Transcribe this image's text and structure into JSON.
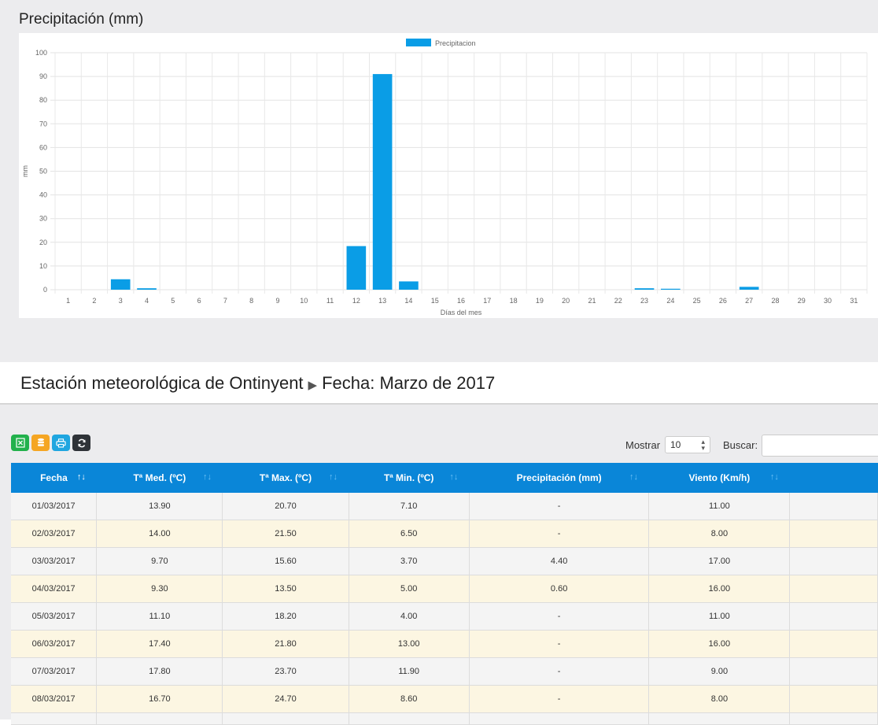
{
  "chart_title": "Precipitación (mm)",
  "chart_data": {
    "type": "bar",
    "legend": "Precipitacion",
    "legend_position": "top-center",
    "xlabel": "Días del mes",
    "ylabel": "mm",
    "ylim": [
      0,
      100
    ],
    "yticks": [
      0,
      10,
      20,
      30,
      40,
      50,
      60,
      70,
      80,
      90,
      100
    ],
    "grid": true,
    "color": "#0a9de6",
    "categories": [
      "1",
      "2",
      "3",
      "4",
      "5",
      "6",
      "7",
      "8",
      "9",
      "10",
      "11",
      "12",
      "13",
      "14",
      "15",
      "16",
      "17",
      "18",
      "19",
      "20",
      "21",
      "22",
      "23",
      "24",
      "25",
      "26",
      "27",
      "28",
      "29",
      "30",
      "31"
    ],
    "values": [
      0,
      0,
      4.4,
      0.6,
      0,
      0,
      0,
      0,
      0,
      0,
      0,
      18.4,
      91.0,
      3.5,
      0,
      0,
      0,
      0,
      0,
      0,
      0,
      0,
      0.6,
      0.4,
      0,
      0,
      1.2,
      0,
      0,
      0,
      0
    ]
  },
  "station": {
    "name": "Estación meteorológica de Ontinyent",
    "arrow": "▶",
    "date": "Fecha: Marzo de 2017"
  },
  "toolbar": {
    "excel_icon": "excel-icon",
    "database_icon": "database-icon",
    "print_icon": "print-icon",
    "refresh_icon": "refresh-icon",
    "show_label": "Mostrar",
    "show_value": "10",
    "search_label": "Buscar:",
    "search_value": ""
  },
  "table": {
    "headers": [
      "Fecha",
      "Tª Med. (ºC)",
      "Tª Max. (ºC)",
      "Tª Min. (ºC)",
      "Precipitación (mm)",
      "Viento (Km/h)",
      ""
    ],
    "rows": [
      [
        "01/03/2017",
        "13.90",
        "20.70",
        "7.10",
        "-",
        "11.00",
        ""
      ],
      [
        "02/03/2017",
        "14.00",
        "21.50",
        "6.50",
        "-",
        "8.00",
        ""
      ],
      [
        "03/03/2017",
        "9.70",
        "15.60",
        "3.70",
        "4.40",
        "17.00",
        ""
      ],
      [
        "04/03/2017",
        "9.30",
        "13.50",
        "5.00",
        "0.60",
        "16.00",
        ""
      ],
      [
        "05/03/2017",
        "11.10",
        "18.20",
        "4.00",
        "-",
        "11.00",
        ""
      ],
      [
        "06/03/2017",
        "17.40",
        "21.80",
        "13.00",
        "-",
        "16.00",
        ""
      ],
      [
        "07/03/2017",
        "17.80",
        "23.70",
        "11.90",
        "-",
        "9.00",
        ""
      ],
      [
        "08/03/2017",
        "16.70",
        "24.70",
        "8.60",
        "-",
        "8.00",
        ""
      ]
    ]
  }
}
